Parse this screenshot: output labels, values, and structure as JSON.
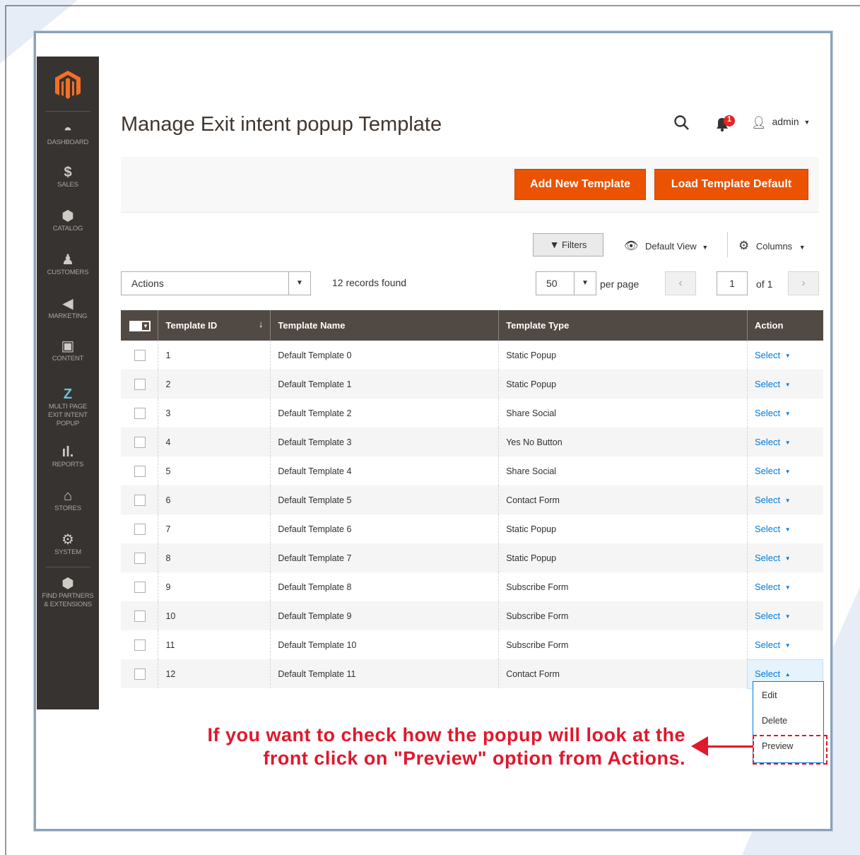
{
  "page": {
    "title": "Manage Exit intent popup Template"
  },
  "sidebar": {
    "items": [
      {
        "icon": "dashboard-icon",
        "label": "DASHBOARD"
      },
      {
        "icon": "dollar-icon",
        "label": "SALES"
      },
      {
        "icon": "cube-icon",
        "label": "CATALOG"
      },
      {
        "icon": "person-icon",
        "label": "CUSTOMERS"
      },
      {
        "icon": "megaphone-icon",
        "label": "MARKETING"
      },
      {
        "icon": "layout-icon",
        "label": "CONTENT"
      },
      {
        "icon": "z-logo-icon",
        "label_lines": [
          "MULTI PAGE",
          "EXIT INTENT",
          "POPUP"
        ]
      },
      {
        "icon": "bar-chart-icon",
        "label": "REPORTS"
      },
      {
        "icon": "store-icon",
        "label": "STORES"
      },
      {
        "icon": "gear-icon",
        "label": "SYSTEM"
      },
      {
        "icon": "box-icon",
        "label_lines": [
          "FIND PARTNERS",
          "& EXTENSIONS"
        ]
      }
    ]
  },
  "header": {
    "notifications_count": "1",
    "user": "admin"
  },
  "toolbar": {
    "add_new": "Add New Template",
    "load_default": "Load Template Default"
  },
  "grid_controls": {
    "filters": "Filters",
    "view": "Default View",
    "columns": "Columns",
    "actions": "Actions",
    "records": "12 records found",
    "per_page_value": "50",
    "per_page_label": "per page",
    "page": "1",
    "of": "of 1"
  },
  "table": {
    "columns": [
      "Template ID",
      "Template Name",
      "Template Type",
      "Action"
    ],
    "rows": [
      {
        "id": "1",
        "name": "Default Template 0",
        "type": "Static Popup",
        "action": "Select"
      },
      {
        "id": "2",
        "name": "Default Template 1",
        "type": "Static Popup",
        "action": "Select"
      },
      {
        "id": "3",
        "name": "Default Template 2",
        "type": "Share Social",
        "action": "Select"
      },
      {
        "id": "4",
        "name": "Default Template 3",
        "type": "Yes No Button",
        "action": "Select"
      },
      {
        "id": "5",
        "name": "Default Template 4",
        "type": "Share Social",
        "action": "Select"
      },
      {
        "id": "6",
        "name": "Default Template 5",
        "type": "Contact Form",
        "action": "Select"
      },
      {
        "id": "7",
        "name": "Default Template 6",
        "type": "Static Popup",
        "action": "Select"
      },
      {
        "id": "8",
        "name": "Default Template 7",
        "type": "Static Popup",
        "action": "Select"
      },
      {
        "id": "9",
        "name": "Default Template 8",
        "type": "Subscribe Form",
        "action": "Select"
      },
      {
        "id": "10",
        "name": "Default Template 9",
        "type": "Subscribe Form",
        "action": "Select"
      },
      {
        "id": "11",
        "name": "Default Template 10",
        "type": "Subscribe Form",
        "action": "Select"
      },
      {
        "id": "12",
        "name": "Default Template 11",
        "type": "Contact Form",
        "action": "Select"
      }
    ]
  },
  "action_menu": {
    "items": [
      "Edit",
      "Delete",
      "Preview"
    ]
  },
  "annotation": {
    "line1": "If you want to check how the popup will look at the",
    "line2": "front click on \"Preview\" option from Actions."
  },
  "colors": {
    "accent": "#eb5202",
    "sidebar": "#373330",
    "header": "#514943",
    "link": "#007bdb",
    "annotation": "#e0182d"
  }
}
